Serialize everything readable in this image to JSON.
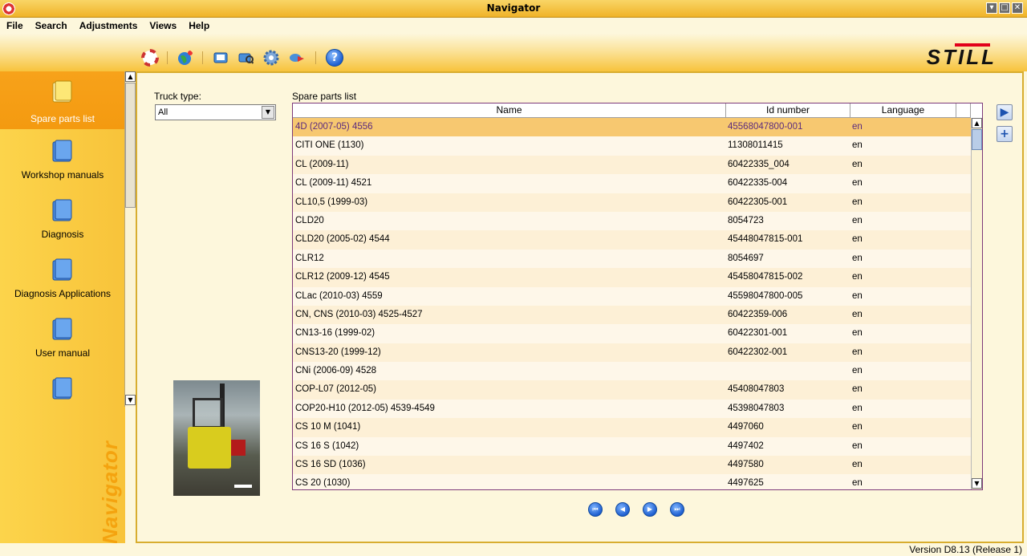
{
  "window": {
    "title": "Navigator"
  },
  "menu": [
    "File",
    "Search",
    "Adjustments",
    "Views",
    "Help"
  ],
  "toolbar": {
    "icons": [
      "lifebuoy-icon",
      "globe-icon",
      "book-icon",
      "magnifier-book-icon",
      "gear-icon",
      "transfer-icon",
      "help-icon"
    ],
    "help_symbol": "?",
    "logo": "STILL"
  },
  "sidebar": {
    "items": [
      {
        "label": "Spare parts list",
        "active": true
      },
      {
        "label": "Workshop manuals"
      },
      {
        "label": "Diagnosis"
      },
      {
        "label": "Diagnosis Applications"
      },
      {
        "label": "User manual"
      },
      {
        "label": ""
      }
    ],
    "brand": "Navigator"
  },
  "filters": {
    "truck_type_label": "Truck type:",
    "truck_type_value": "All"
  },
  "spare_parts": {
    "label": "Spare parts list",
    "columns": [
      "Name",
      "Id number",
      "Language"
    ],
    "rows": [
      {
        "name": "4D (2007-05) 4556",
        "id": "45568047800-001",
        "lang": "en"
      },
      {
        "name": "CITI ONE (1130)",
        "id": "11308011415",
        "lang": "en"
      },
      {
        "name": "CL (2009-11)",
        "id": "60422335_004",
        "lang": "en"
      },
      {
        "name": "CL (2009-11) 4521",
        "id": "60422335-004",
        "lang": "en"
      },
      {
        "name": "CL10,5 (1999-03)",
        "id": "60422305-001",
        "lang": "en"
      },
      {
        "name": "CLD20",
        "id": "8054723",
        "lang": "en"
      },
      {
        "name": "CLD20 (2005-02) 4544",
        "id": "45448047815-001",
        "lang": "en"
      },
      {
        "name": "CLR12",
        "id": "8054697",
        "lang": "en"
      },
      {
        "name": "CLR12 (2009-12) 4545",
        "id": "45458047815-002",
        "lang": "en"
      },
      {
        "name": "CLac (2010-03) 4559",
        "id": "45598047800-005",
        "lang": "en"
      },
      {
        "name": "CN, CNS (2010-03) 4525-4527",
        "id": "60422359-006",
        "lang": "en"
      },
      {
        "name": "CN13-16 (1999-02)",
        "id": "60422301-001",
        "lang": "en"
      },
      {
        "name": "CNS13-20 (1999-12)",
        "id": "60422302-001",
        "lang": "en"
      },
      {
        "name": "CNi (2006-09) 4528",
        "id": "",
        "lang": "en"
      },
      {
        "name": "COP-L07 (2012-05)",
        "id": "45408047803",
        "lang": "en"
      },
      {
        "name": "COP20-H10 (2012-05) 4539-4549",
        "id": "45398047803",
        "lang": "en"
      },
      {
        "name": "CS 10 M (1041)",
        "id": "4497060",
        "lang": "en"
      },
      {
        "name": "CS 16 S (1042)",
        "id": "4497402",
        "lang": "en"
      },
      {
        "name": "CS 16 SD (1036)",
        "id": "4497580",
        "lang": "en"
      },
      {
        "name": "CS 20 (1030)",
        "id": "4497625",
        "lang": "en"
      }
    ]
  },
  "status": {
    "version": "Version D8.13 (Release 1)"
  },
  "colors": {
    "accent": "#f7a21a",
    "selected_row": "#f7c870",
    "table_border": "#7d3a7a"
  }
}
